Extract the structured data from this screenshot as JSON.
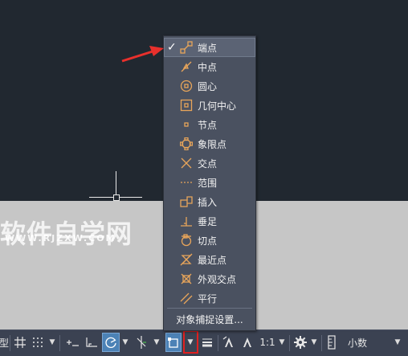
{
  "watermark": {
    "main": "软件自学网",
    "sub": "WWW.RJZXW.COM"
  },
  "menu": {
    "items": [
      {
        "label": "端点",
        "icon": "endpoint-icon",
        "checked": true
      },
      {
        "label": "中点",
        "icon": "midpoint-icon"
      },
      {
        "label": "圆心",
        "icon": "center-icon"
      },
      {
        "label": "几何中心",
        "icon": "geometric-center-icon"
      },
      {
        "label": "节点",
        "icon": "node-icon"
      },
      {
        "label": "象限点",
        "icon": "quadrant-icon"
      },
      {
        "label": "交点",
        "icon": "intersection-icon"
      },
      {
        "label": "范围",
        "icon": "extension-icon"
      },
      {
        "label": "插入",
        "icon": "insertion-icon"
      },
      {
        "label": "垂足",
        "icon": "perpendicular-icon"
      },
      {
        "label": "切点",
        "icon": "tangent-icon"
      },
      {
        "label": "最近点",
        "icon": "nearest-icon"
      },
      {
        "label": "外观交点",
        "icon": "apparent-intersection-icon"
      },
      {
        "label": "平行",
        "icon": "parallel-icon"
      }
    ],
    "settings_label": "对象捕捉设置...",
    "check_mark": "✓"
  },
  "statusbar": {
    "left_text": "型",
    "scale": "1:1",
    "units": "小数"
  },
  "colors": {
    "icon_orange": "#e8a55a",
    "highlight_red": "#e02020",
    "pointer_red": "#e8302c"
  }
}
